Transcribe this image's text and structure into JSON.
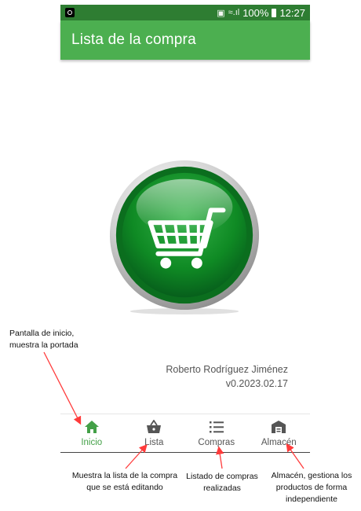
{
  "status_bar": {
    "battery": "100%",
    "time": "12:27"
  },
  "app_bar": {
    "title": "Lista de la compra"
  },
  "splash": {
    "author": "Roberto Rodríguez Jiménez",
    "version": "v0.2023.02.17"
  },
  "bottom_nav": [
    {
      "label": "Inicio",
      "icon": "home-icon",
      "active": true
    },
    {
      "label": "Lista",
      "icon": "basket-icon"
    },
    {
      "label": "Compras",
      "icon": "list-icon"
    },
    {
      "label": "Almacén",
      "icon": "warehouse-icon"
    }
  ],
  "annotations": {
    "inicio": "Pantalla de inicio,\nmuestra la portada",
    "lista": "Muestra la lista de la compra\nque se está editando",
    "compras": "Listado de compras\nrealizadas",
    "almacen": "Almacén, gestiona los\nproductos de forma\nindependiente"
  },
  "colors": {
    "primary": "#4caf50",
    "primary_dark": "#2e7d32",
    "annotation_arrow": "#ff3b3b"
  }
}
